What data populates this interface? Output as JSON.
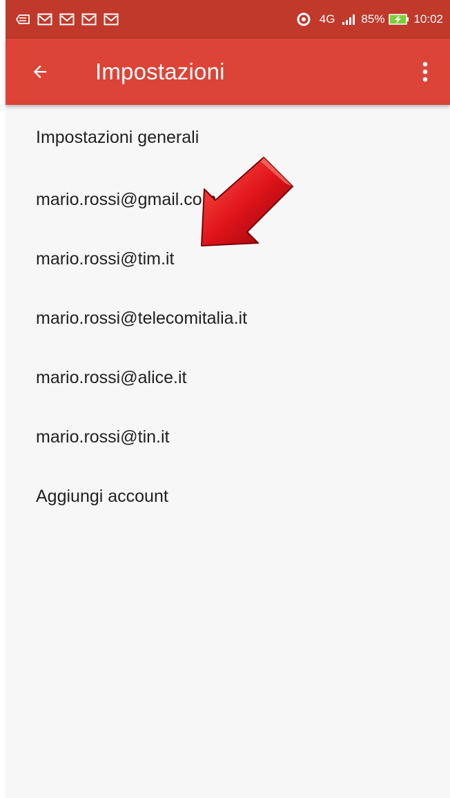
{
  "status_bar": {
    "network": "4G",
    "battery": "85%",
    "time": "10:02",
    "notification_icons": [
      "email-icon",
      "gmail-icon",
      "gmail-icon",
      "gmail-icon",
      "gmail-icon"
    ],
    "colors": {
      "background": "#c0392b"
    }
  },
  "app_bar": {
    "title": "Impostazioni",
    "back_icon": "arrow-back-icon",
    "menu_icon": "more-vert-icon",
    "colors": {
      "background": "#db4437",
      "text": "#ffffff"
    }
  },
  "settings": {
    "items": [
      {
        "label": "Impostazioni generali"
      },
      {
        "label": "mario.rossi@gmail.com"
      },
      {
        "label": "mario.rossi@tim.it"
      },
      {
        "label": "mario.rossi@telecomitalia.it"
      },
      {
        "label": "mario.rossi@alice.it"
      },
      {
        "label": "mario.rossi@tin.it"
      },
      {
        "label": "Aggiungi account"
      }
    ]
  },
  "annotation": {
    "icon": "red-arrow-icon",
    "color": "#d0021b"
  }
}
